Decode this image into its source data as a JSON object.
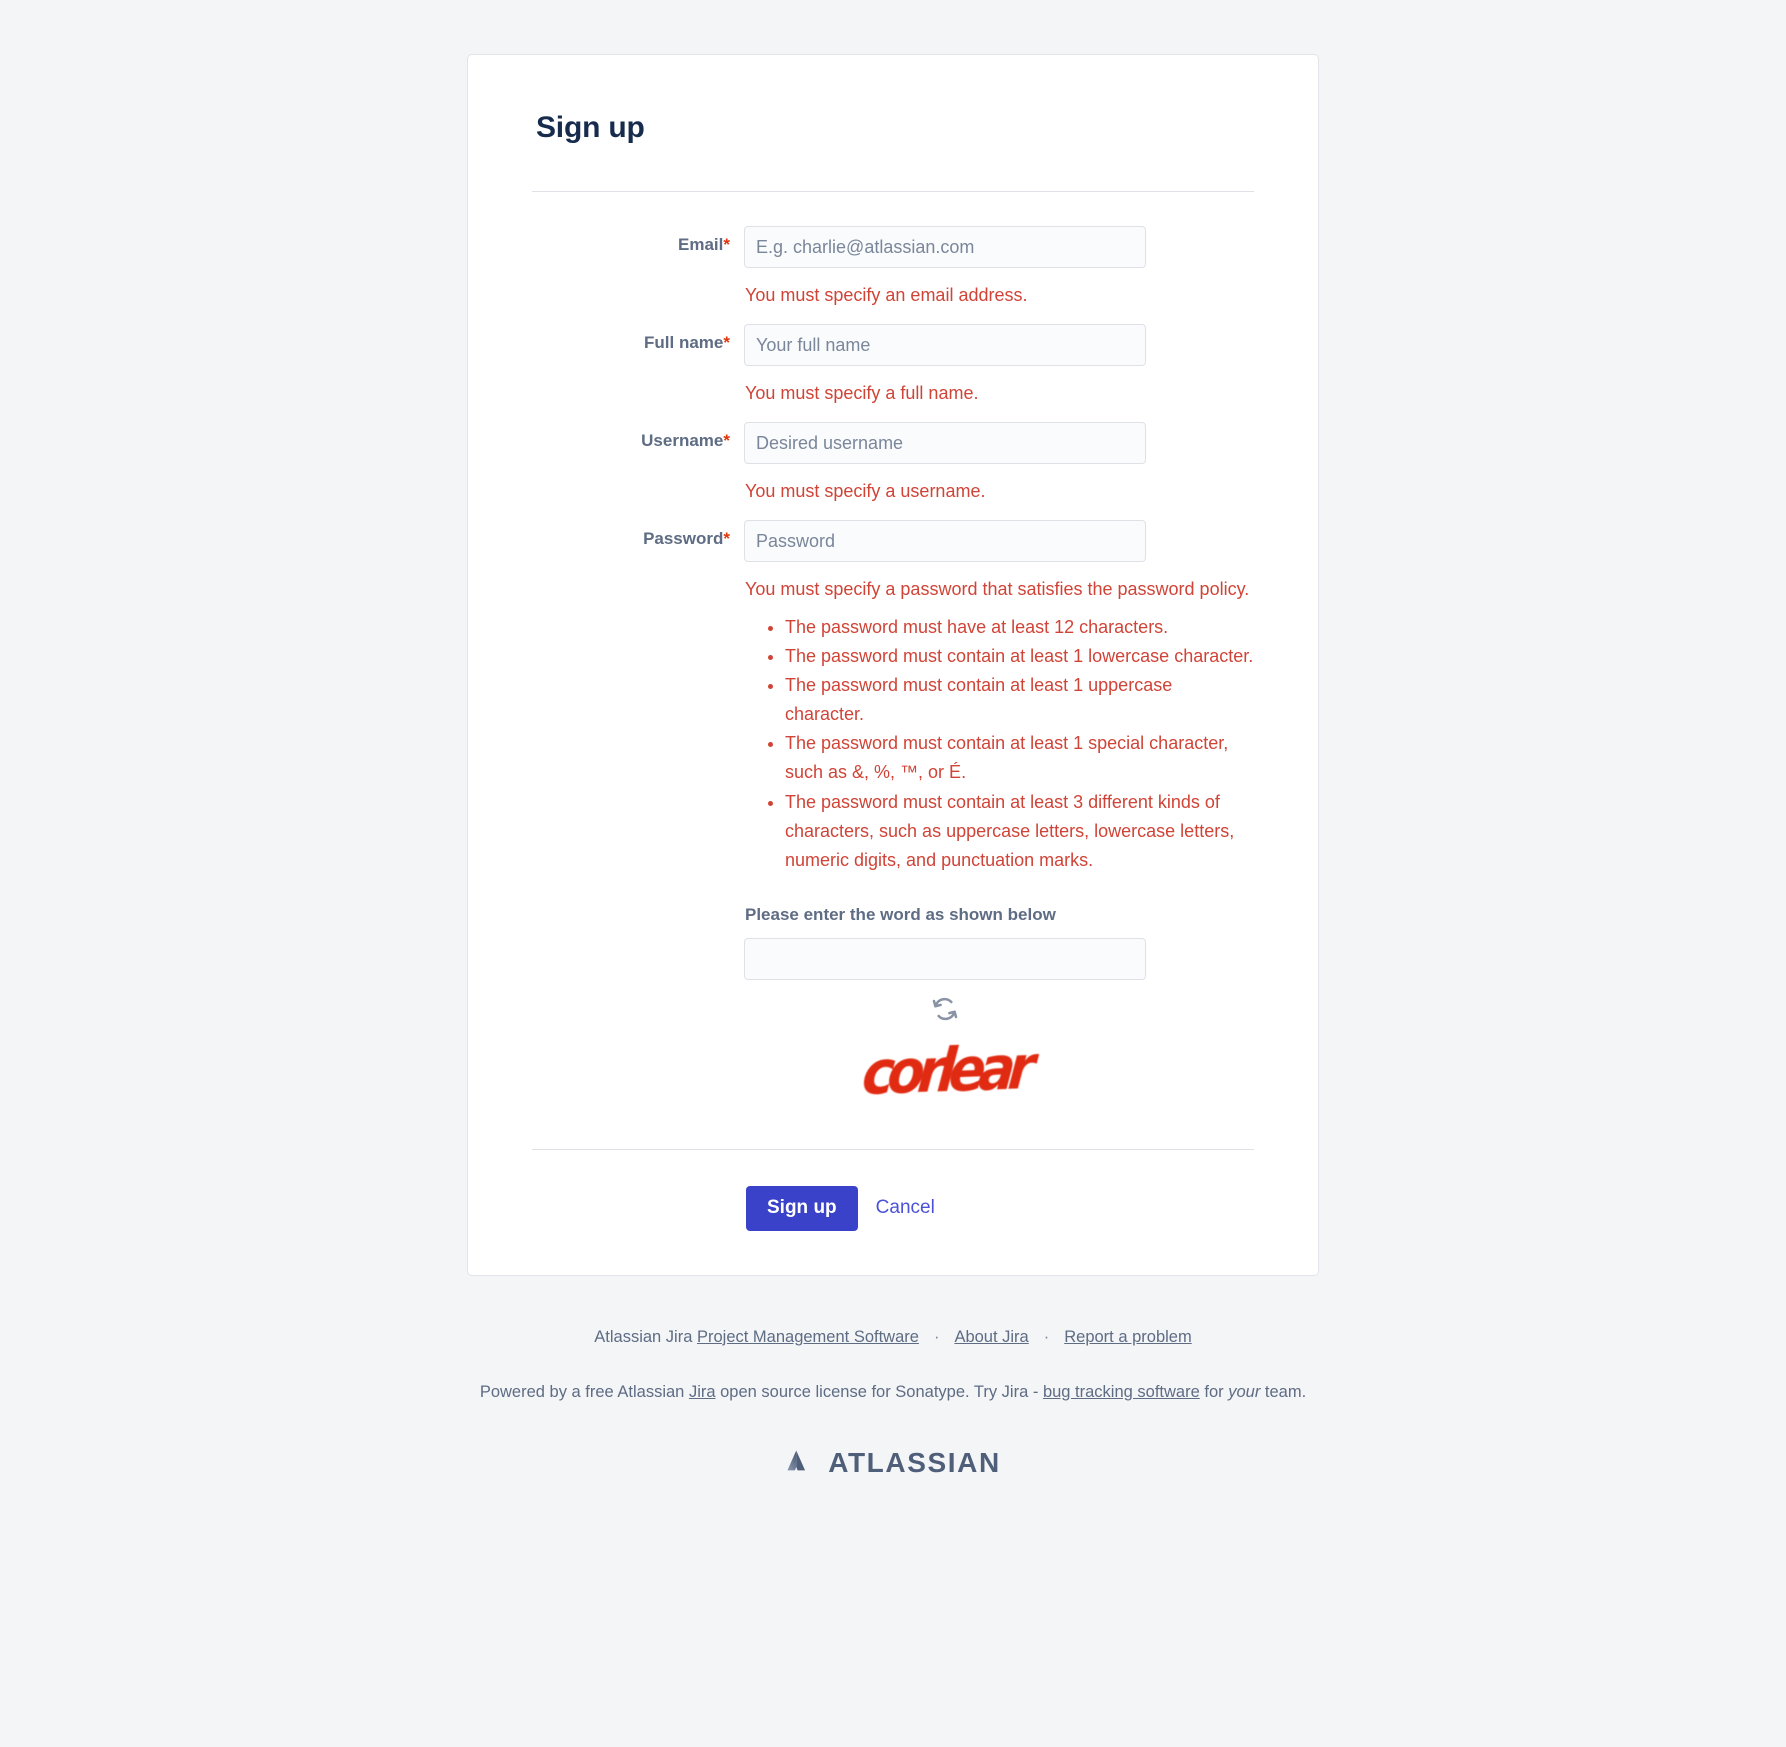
{
  "page": {
    "title": "Sign up"
  },
  "form": {
    "fields": [
      {
        "label": "Email",
        "required_mark": "*",
        "placeholder": "E.g. charlie@atlassian.com",
        "value": "",
        "error": "You must specify an email address."
      },
      {
        "label": "Full name",
        "required_mark": "*",
        "placeholder": "Your full name",
        "value": "",
        "error": "You must specify a full name."
      },
      {
        "label": "Username",
        "required_mark": "*",
        "placeholder": "Desired username",
        "value": "",
        "error": "You must specify a username."
      },
      {
        "label": "Password",
        "required_mark": "*",
        "placeholder": "Password",
        "value": "",
        "error": "You must specify a password that satisfies the password policy."
      }
    ],
    "password_policy": [
      "The password must have at least 12 characters.",
      "The password must contain at least 1 lowercase character.",
      "The password must contain at least 1 uppercase character.",
      "The password must contain at least 1 special character, such as &, %, ™, or É.",
      "The password must contain at least 3 different kinds of characters, such as uppercase letters, lowercase letters, numeric digits, and punctuation marks."
    ]
  },
  "captcha": {
    "label": "Please enter the word as shown below",
    "placeholder": "",
    "value": "",
    "word": "corlear",
    "refresh_icon": "refresh-icon"
  },
  "actions": {
    "submit_label": "Sign up",
    "cancel_label": "Cancel"
  },
  "footer": {
    "line1": {
      "prefix": "Atlassian Jira ",
      "link1": "Project Management Software",
      "sep": "·",
      "link2": "About Jira",
      "link3": "Report a problem"
    },
    "line2": {
      "part1": "Powered by a free Atlassian ",
      "link_jira": "Jira",
      "part2": " open source license for Sonatype. Try Jira - ",
      "link_bug": "bug tracking software",
      "part3": " for ",
      "emphasis": "your",
      "part4": " team."
    },
    "brand": "ATLASSIAN"
  },
  "colors": {
    "error": "#d04437",
    "primary": "#3942c9",
    "link": "#4b52d8",
    "label": "#5e6c84",
    "title": "#172b4d",
    "captcha": "#e02b12",
    "page_bg": "#f4f5f7"
  }
}
